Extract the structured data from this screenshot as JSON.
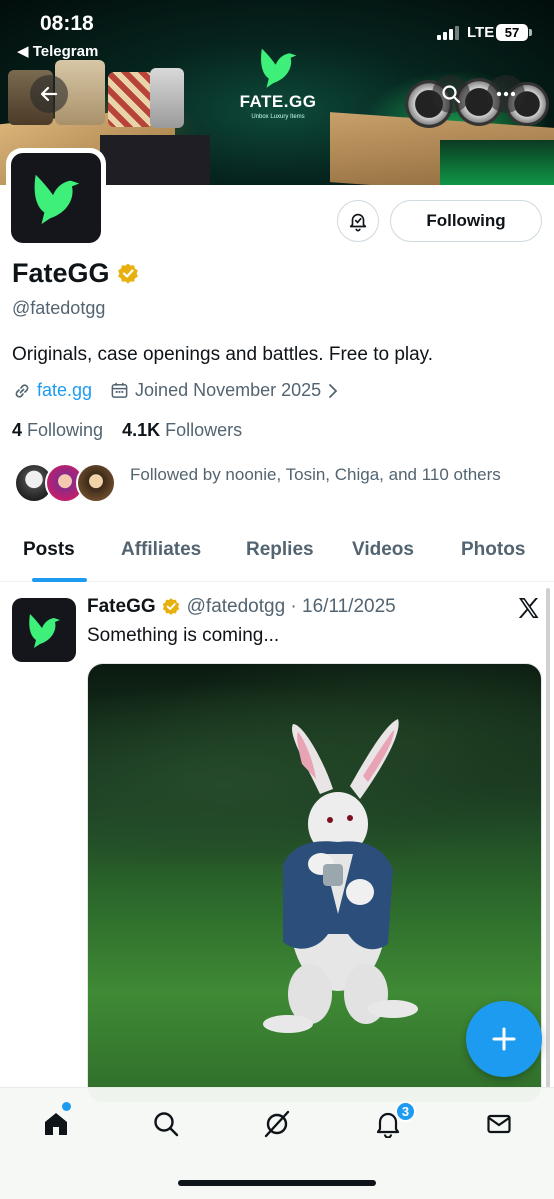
{
  "status_bar": {
    "time": "08:18",
    "back_app": "◀ Telegram",
    "network": "LTE",
    "battery": "57"
  },
  "banner": {
    "logo_title": "FATE.GG",
    "logo_subtitle": "Unbox Luxury Items"
  },
  "profile": {
    "name": "FateGG",
    "handle": "@fatedotgg",
    "bio": "Originals, case openings and battles. Free to play.",
    "website": "fate.gg",
    "joined": "Joined November 2025",
    "following_count": "4",
    "following_label": "Following",
    "followers_count": "4.1K",
    "followers_label": "Followers",
    "followed_by": "Followed by noonie, Tosin, Chiga, and 110 others",
    "follow_button": "Following"
  },
  "tabs": [
    "Posts",
    "Affiliates",
    "Replies",
    "Videos",
    "Photos"
  ],
  "active_tab": "Posts",
  "post": {
    "author": "FateGG",
    "handle_date": "@fatedotgg · 16/11/2025",
    "text": "Something is coming..."
  },
  "nav": {
    "notifications_badge": "3"
  },
  "colors": {
    "accent": "#1d9bf0",
    "brand_green": "#3ef07a",
    "verified_gold": "#e8b00f"
  },
  "icons": {
    "back": "arrow-left-icon",
    "search": "search-icon",
    "more": "more-horizontal-icon",
    "bell": "bell-plus-icon",
    "link": "link-icon",
    "calendar": "calendar-icon",
    "compose": "plus-icon",
    "home": "home-icon",
    "explore": "search-icon",
    "grok": "grok-icon",
    "notifications": "bell-icon",
    "messages": "mail-icon"
  }
}
